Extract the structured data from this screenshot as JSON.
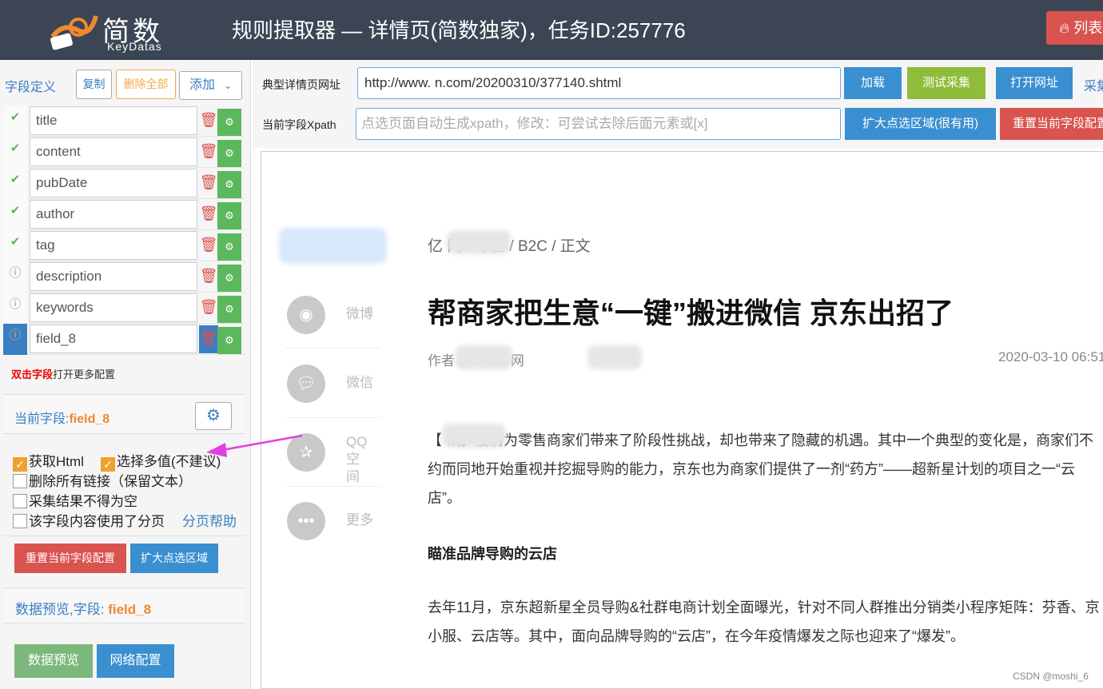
{
  "app": {
    "logo_cn": "简数",
    "logo_en": "KeyDatas",
    "title": "规则提取器 — 详情页(简数独家)，任务ID:257776",
    "list_button": "列表"
  },
  "left_panel": {
    "fields_title": "字段定义",
    "copy_label": "复制",
    "delete_all_label": "删除全部",
    "add_label": "添加",
    "fields": [
      {
        "name": "title",
        "status": "✔"
      },
      {
        "name": "content",
        "status": "✔"
      },
      {
        "name": "pubDate",
        "status": "✔"
      },
      {
        "name": "author",
        "status": "✔"
      },
      {
        "name": "tag",
        "status": "✔"
      },
      {
        "name": "description",
        "status": "ⓘ"
      },
      {
        "name": "keywords",
        "status": "ⓘ"
      },
      {
        "name": "field_8",
        "status": "ⓘ"
      }
    ],
    "hint_bold": "双击字段",
    "hint_rest": "打开更多配置",
    "current_field_label": "当前字段:",
    "current_field_value": "field_8",
    "options": {
      "get_html": "获取Html",
      "multi_value": "选择多值(不建议)",
      "remove_links": "删除所有链接（保留文本）",
      "not_empty": "采集结果不得为空",
      "paging": "该字段内容使用了分页",
      "paging_help": "分页帮助"
    },
    "reset_button": "重置当前字段配置",
    "expand_button": "扩大点选区域",
    "preview_label": "数据预览,字段:",
    "preview_field": "field_8",
    "data_preview_button": "数据预览",
    "network_button": "网络配置"
  },
  "toolbar": {
    "url_label": "典型详情页网址",
    "url_value": "http://www.        n.com/20200310/377140.shtml",
    "load_button": "加载",
    "test_button": "测试采集",
    "open_button": "打开网址",
    "collect_label": "采集",
    "xpath_label": "当前字段Xpath",
    "xpath_placeholder": "点选页面自动生成xpath，修改：可尝试去除后面元素或[x]",
    "expand_button": "扩大点选区域(很有用)",
    "reset_button": "重置当前字段配置"
  },
  "article": {
    "share": [
      {
        "icon": "weibo-icon",
        "label": "微博"
      },
      {
        "icon": "wechat-icon",
        "label": "微信"
      },
      {
        "icon": "qzone-icon",
        "label": "QQ\n空间"
      },
      {
        "icon": "more-icon",
        "label": "更多"
      }
    ],
    "breadcrumb": "亿        网  /  零售  /  B2C  /  正文",
    "headline": "帮商家把生意“一键”搬进微信 京东出招了",
    "meta": "作者        网    来源:        网",
    "date": "2020-03-10 06:51",
    "para1": "【         讯】疫情为零售商家们带来了阶段性挑战，却也带来了隐藏的机遇。其中一个典型的变化是，商家们不约而同地开始重视并挖掘导购的能力，京东也为商家们提供了一剂“药方”——超新星计划的项目之一“云店”。",
    "subheading": "瞄准品牌导购的云店",
    "para2": "去年11月，京东超新星全员导购&社群电商计划全面曝光，针对不同人群推出分销类小程序矩阵：芬香、京小服、云店等。其中，面向品牌导购的“云店”，在今年疫情爆发之际也迎来了“爆发”。"
  },
  "watermark": "CSDN @moshi_6",
  "colors": {
    "topbar": "#3c4554",
    "accent_blue": "#3a7fc4",
    "danger": "#d9534f",
    "success": "#5cb85c",
    "olive": "#8fbc3a"
  }
}
